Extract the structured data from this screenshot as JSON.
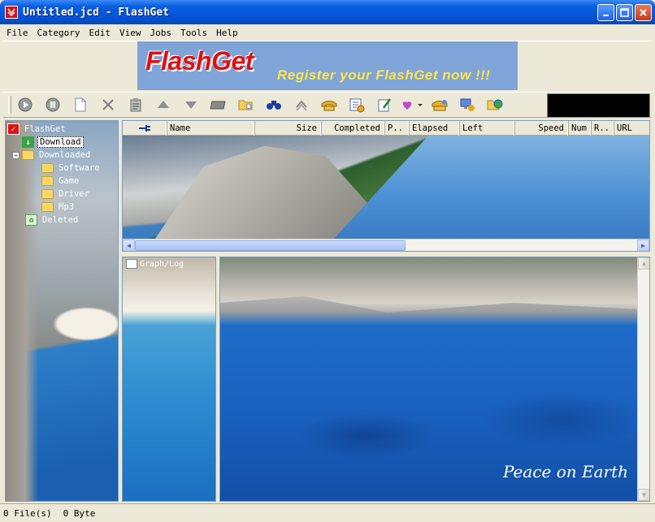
{
  "window": {
    "title": "Untitled.jcd - FlashGet"
  },
  "menu": [
    "File",
    "Category",
    "Edit",
    "View",
    "Jobs",
    "Tools",
    "Help"
  ],
  "banner": {
    "logo": "FlashGet",
    "tagline": "Register your FlashGet now !!!"
  },
  "toolbar": {
    "buttons": [
      "play-icon",
      "pause-icon",
      "new-file-icon",
      "delete-icon",
      "clipboard-icon",
      "move-up-icon",
      "move-down-icon",
      "battery-icon",
      "open-folder-icon",
      "binoculars-icon",
      "speed-icon",
      "phone-icon",
      "settings-icon",
      "edit-icon",
      "heart-icon",
      "dialup-icon",
      "network-icon",
      "globe-icon"
    ]
  },
  "tree": {
    "root": "FlashGet",
    "items": [
      {
        "label": "Download",
        "level": 1,
        "selected": true
      },
      {
        "label": "Downloaded",
        "level": 1,
        "expander": "−"
      },
      {
        "label": "Software",
        "level": 2
      },
      {
        "label": "Game",
        "level": 2
      },
      {
        "label": "Driver",
        "level": 2
      },
      {
        "label": "Mp3",
        "level": 2
      },
      {
        "label": "Deleted",
        "level": 1
      }
    ]
  },
  "list": {
    "columns": [
      "",
      "Name",
      "Size",
      "Completed",
      "P..",
      "Elapsed",
      "Left",
      "Speed",
      "Num",
      "R..",
      "URL"
    ]
  },
  "graph": {
    "label": "Graph/Log"
  },
  "photo": {
    "caption": "Peace on Earth"
  },
  "status": {
    "files": "0 File(s)",
    "bytes": "0 Byte"
  }
}
